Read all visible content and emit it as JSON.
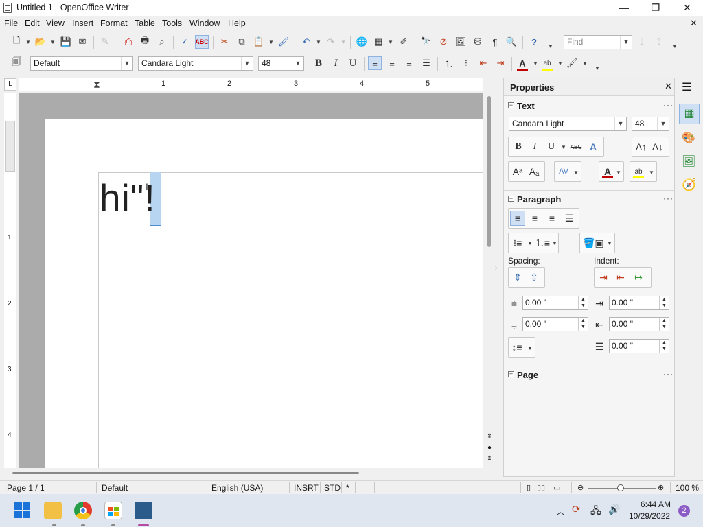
{
  "window": {
    "title": "Untitled 1 - OpenOffice Writer",
    "minimize_glyph": "—",
    "maximize_glyph": "❐",
    "close_glyph": "✕",
    "doc_close_glyph": "✕"
  },
  "menu": [
    "File",
    "Edit",
    "View",
    "Insert",
    "Format",
    "Table",
    "Tools",
    "Window",
    "Help"
  ],
  "find": {
    "placeholder": "Find"
  },
  "formatting": {
    "paragraph_style": "Default",
    "font_name": "Candara Light",
    "font_size": "48",
    "bold": "B",
    "italic": "I",
    "underline": "U"
  },
  "document": {
    "text_before": "hi\"",
    "selected_text": "!"
  },
  "ruler": {
    "h_numbers": [
      "1",
      "2",
      "3",
      "4",
      "5"
    ],
    "v_numbers": [
      "1",
      "2",
      "3",
      "4"
    ]
  },
  "sidebar": {
    "title": "Properties",
    "close_glyph": "✕",
    "text_section": {
      "title": "Text",
      "font_name": "Candara Light",
      "font_size": "48",
      "bold": "B",
      "italic": "I",
      "underline": "U",
      "strike": "ABC"
    },
    "paragraph_section": {
      "title": "Paragraph",
      "spacing_label": "Spacing:",
      "indent_label": "Indent:",
      "above": "0.00 \"",
      "below": "0.00 \"",
      "before_text": "0.00 \"",
      "after_text": "0.00 \"",
      "first_line": "0.00 \""
    },
    "page_section": {
      "title": "Page"
    },
    "more_glyph": "···",
    "expand_glyph": "+",
    "collapse_glyph": "−"
  },
  "statusbar": {
    "page": "Page 1 / 1",
    "style": "Default",
    "language": "English (USA)",
    "insert_mode": "INSRT",
    "selection_mode": "STD",
    "modified": "*",
    "zoom": "100 %"
  },
  "taskbar": {
    "time": "6:44 AM",
    "date": "10/29/2022",
    "notification_count": "2"
  },
  "colors": {
    "font_color": "#c00000",
    "highlight": "#ffff00",
    "selection": "#b7d4f0",
    "taskbar": "#dfe6ef"
  }
}
